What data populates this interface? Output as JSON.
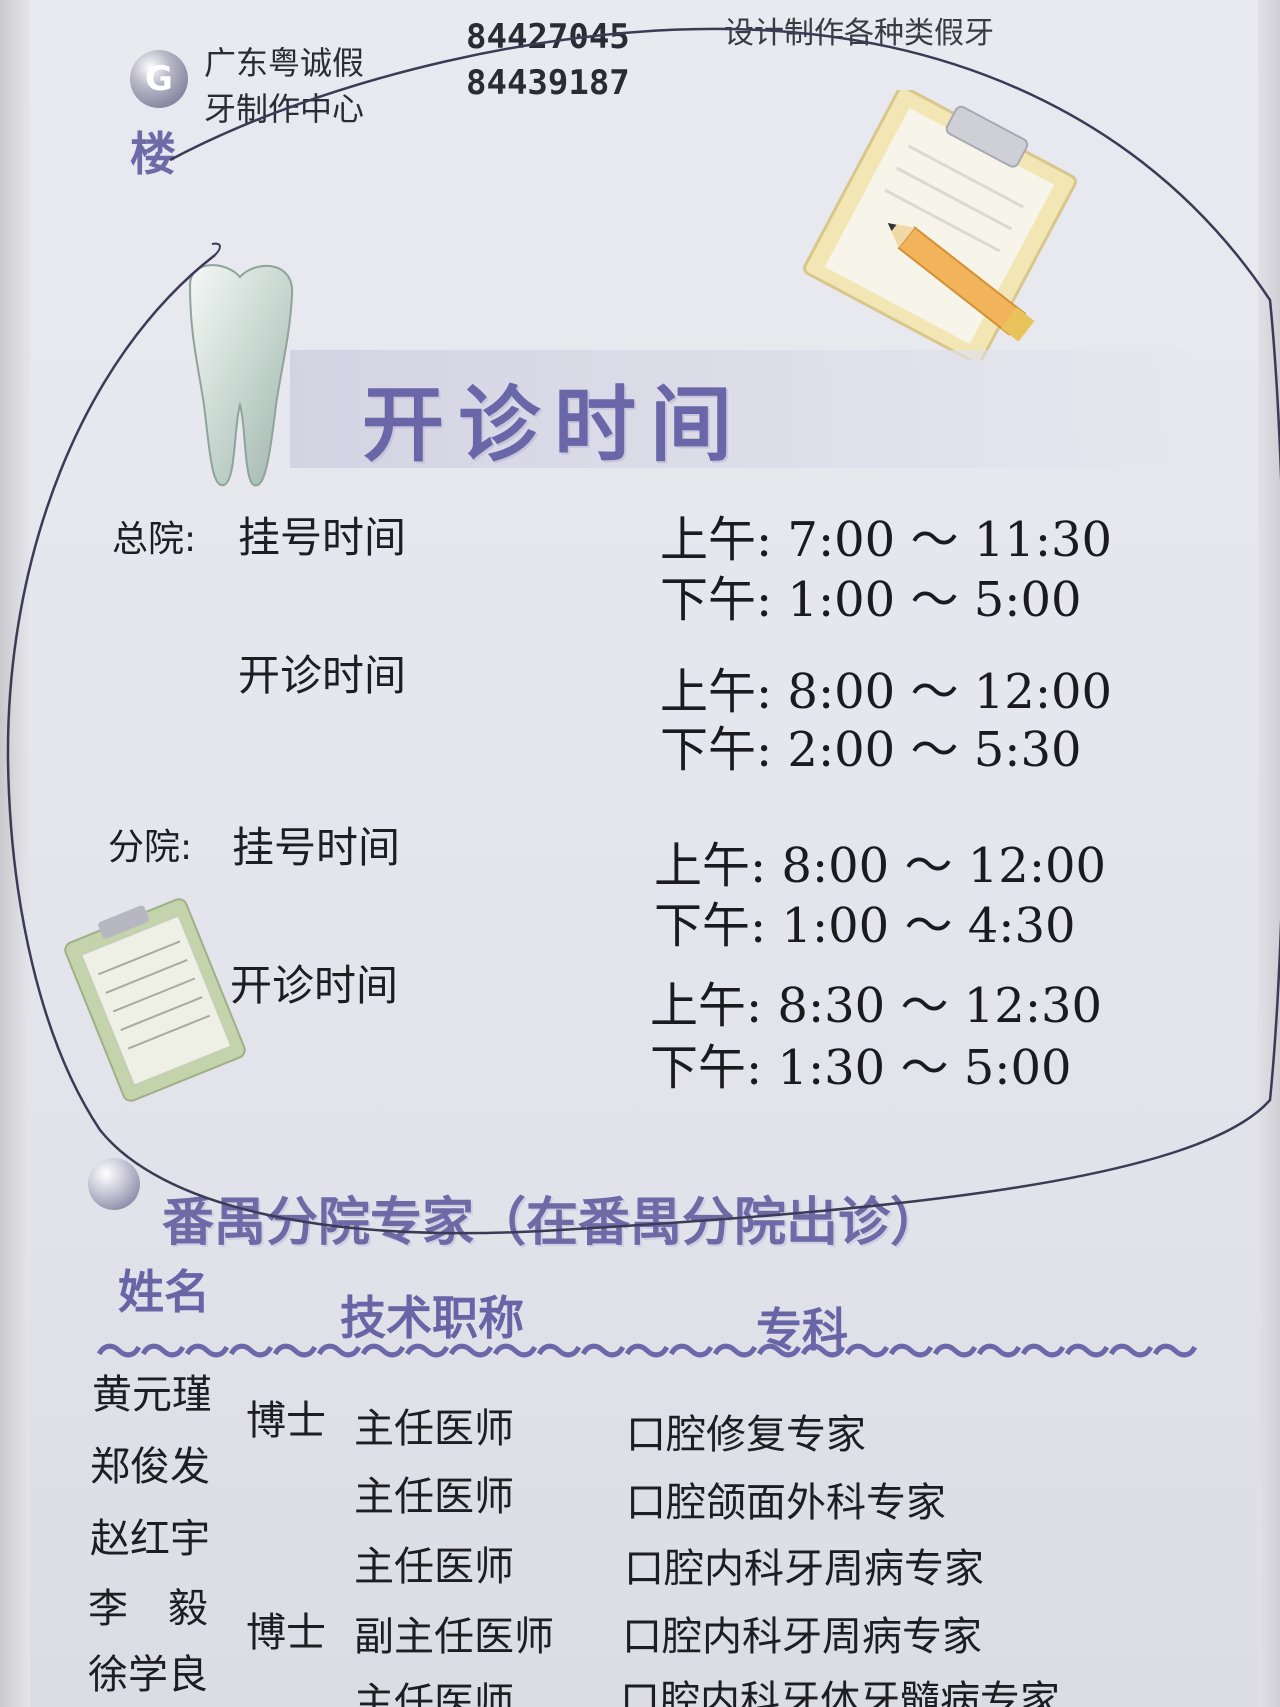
{
  "header": {
    "badge_letter": "G",
    "floor": "楼",
    "company_line1": "广东粤诚假",
    "company_line2": "牙制作中心",
    "phone1": "84427045",
    "phone2": "84439187",
    "slogan": "设计制作各种类假牙"
  },
  "title": "开诊时间",
  "schedule": {
    "main": {
      "label": "总院:",
      "register_label": "挂号时间",
      "register_am": "上午: 7:00 ～ 11:30",
      "register_pm": "下午: 1:00 ～ 5:00",
      "clinic_label": "开诊时间",
      "clinic_am": "上午: 8:00 ～ 12:00",
      "clinic_pm": "下午: 2:00 ～ 5:30"
    },
    "branch": {
      "label": "分院:",
      "register_label": "挂号时间",
      "register_am": "上午: 8:00 ～ 12:00",
      "register_pm": "下午: 1:00 ～ 4:30",
      "clinic_label": "开诊时间",
      "clinic_am": "上午: 8:30 ～ 12:30",
      "clinic_pm": "下午: 1:30 ～ 5:00"
    }
  },
  "experts": {
    "section_title": "番禺分院专家（在番禺分院出诊）",
    "headers": {
      "name": "姓名",
      "title": "技术职称",
      "specialty": "专科"
    },
    "divider": "～～～～～～～～～～～～～～～～～～～～～～～～～",
    "rows": [
      {
        "name": "黄元瑾",
        "degree": "博士",
        "title": "主任医师",
        "specialty": "口腔修复专家"
      },
      {
        "name": "郑俊发",
        "degree": "",
        "title": "主任医师",
        "specialty": "口腔颌面外科专家"
      },
      {
        "name": "赵红宇",
        "degree": "",
        "title": "主任医师",
        "specialty": "口腔内科牙周病专家"
      },
      {
        "name": "李　毅",
        "degree": "博士",
        "title": "副主任医师",
        "specialty": "口腔内科牙周病专家"
      },
      {
        "name": "徐学良",
        "degree": "",
        "title": "主任医师",
        "specialty": "口腔内科牙体牙髓病专家"
      }
    ]
  }
}
